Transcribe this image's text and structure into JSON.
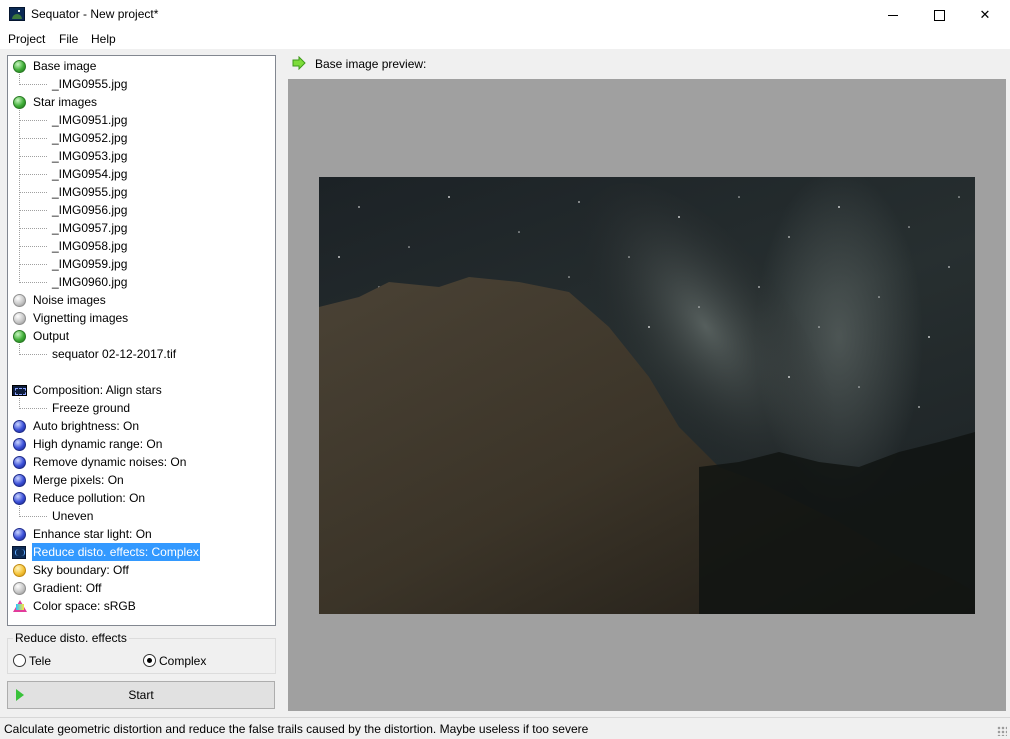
{
  "window": {
    "title": "Sequator - New project*",
    "icon": "sequator-app-icon"
  },
  "menu": [
    "Project",
    "File",
    "Help"
  ],
  "tree": {
    "base_image": {
      "label": "Base image",
      "status": "green",
      "children": [
        "_IMG0955.jpg"
      ]
    },
    "star_images": {
      "label": "Star images",
      "status": "green",
      "children": [
        "_IMG0951.jpg",
        "_IMG0952.jpg",
        "_IMG0953.jpg",
        "_IMG0954.jpg",
        "_IMG0955.jpg",
        "_IMG0956.jpg",
        "_IMG0957.jpg",
        "_IMG0958.jpg",
        "_IMG0959.jpg",
        "_IMG0960.jpg"
      ]
    },
    "noise_images": {
      "label": "Noise images",
      "status": "gray"
    },
    "vignetting_images": {
      "label": "Vignetting images",
      "status": "gray"
    },
    "output": {
      "label": "Output",
      "status": "green",
      "children": [
        "sequator 02-12-2017.tif"
      ]
    },
    "composition": {
      "label": "Composition: Align stars",
      "children": [
        "Freeze ground"
      ]
    },
    "auto_brightness": {
      "label": "Auto brightness: On",
      "status": "blue"
    },
    "hdr": {
      "label": "High dynamic range: On",
      "status": "blue"
    },
    "remove_noise": {
      "label": "Remove dynamic noises: On",
      "status": "blue"
    },
    "merge_pixels": {
      "label": "Merge pixels: On",
      "status": "blue"
    },
    "reduce_pollution": {
      "label": "Reduce pollution: On",
      "status": "blue",
      "children": [
        "Uneven"
      ]
    },
    "enhance_star": {
      "label": "Enhance star light: On",
      "status": "blue"
    },
    "reduce_disto": {
      "label": "Reduce disto. effects: Complex",
      "selected": true
    },
    "sky_boundary": {
      "label": "Sky boundary: Off",
      "status": "yellow"
    },
    "gradient": {
      "label": "Gradient: Off",
      "status": "gray"
    },
    "color_space": {
      "label": "Color space: sRGB"
    }
  },
  "options_group": {
    "title": "Reduce disto. effects",
    "options": [
      {
        "label": "Tele",
        "selected": false
      },
      {
        "label": "Complex",
        "selected": true
      }
    ]
  },
  "start_button": "Start",
  "preview": {
    "title": "Base image preview:",
    "image": "Milky Way over rock formation at night"
  },
  "status_bar": "Calculate geometric distortion and reduce the false trails caused by the distortion. Maybe useless if too severe",
  "colors": {
    "selection": "#3399ff",
    "preview_bg": "#a0a0a0",
    "window_bg": "#f0f0f0"
  }
}
